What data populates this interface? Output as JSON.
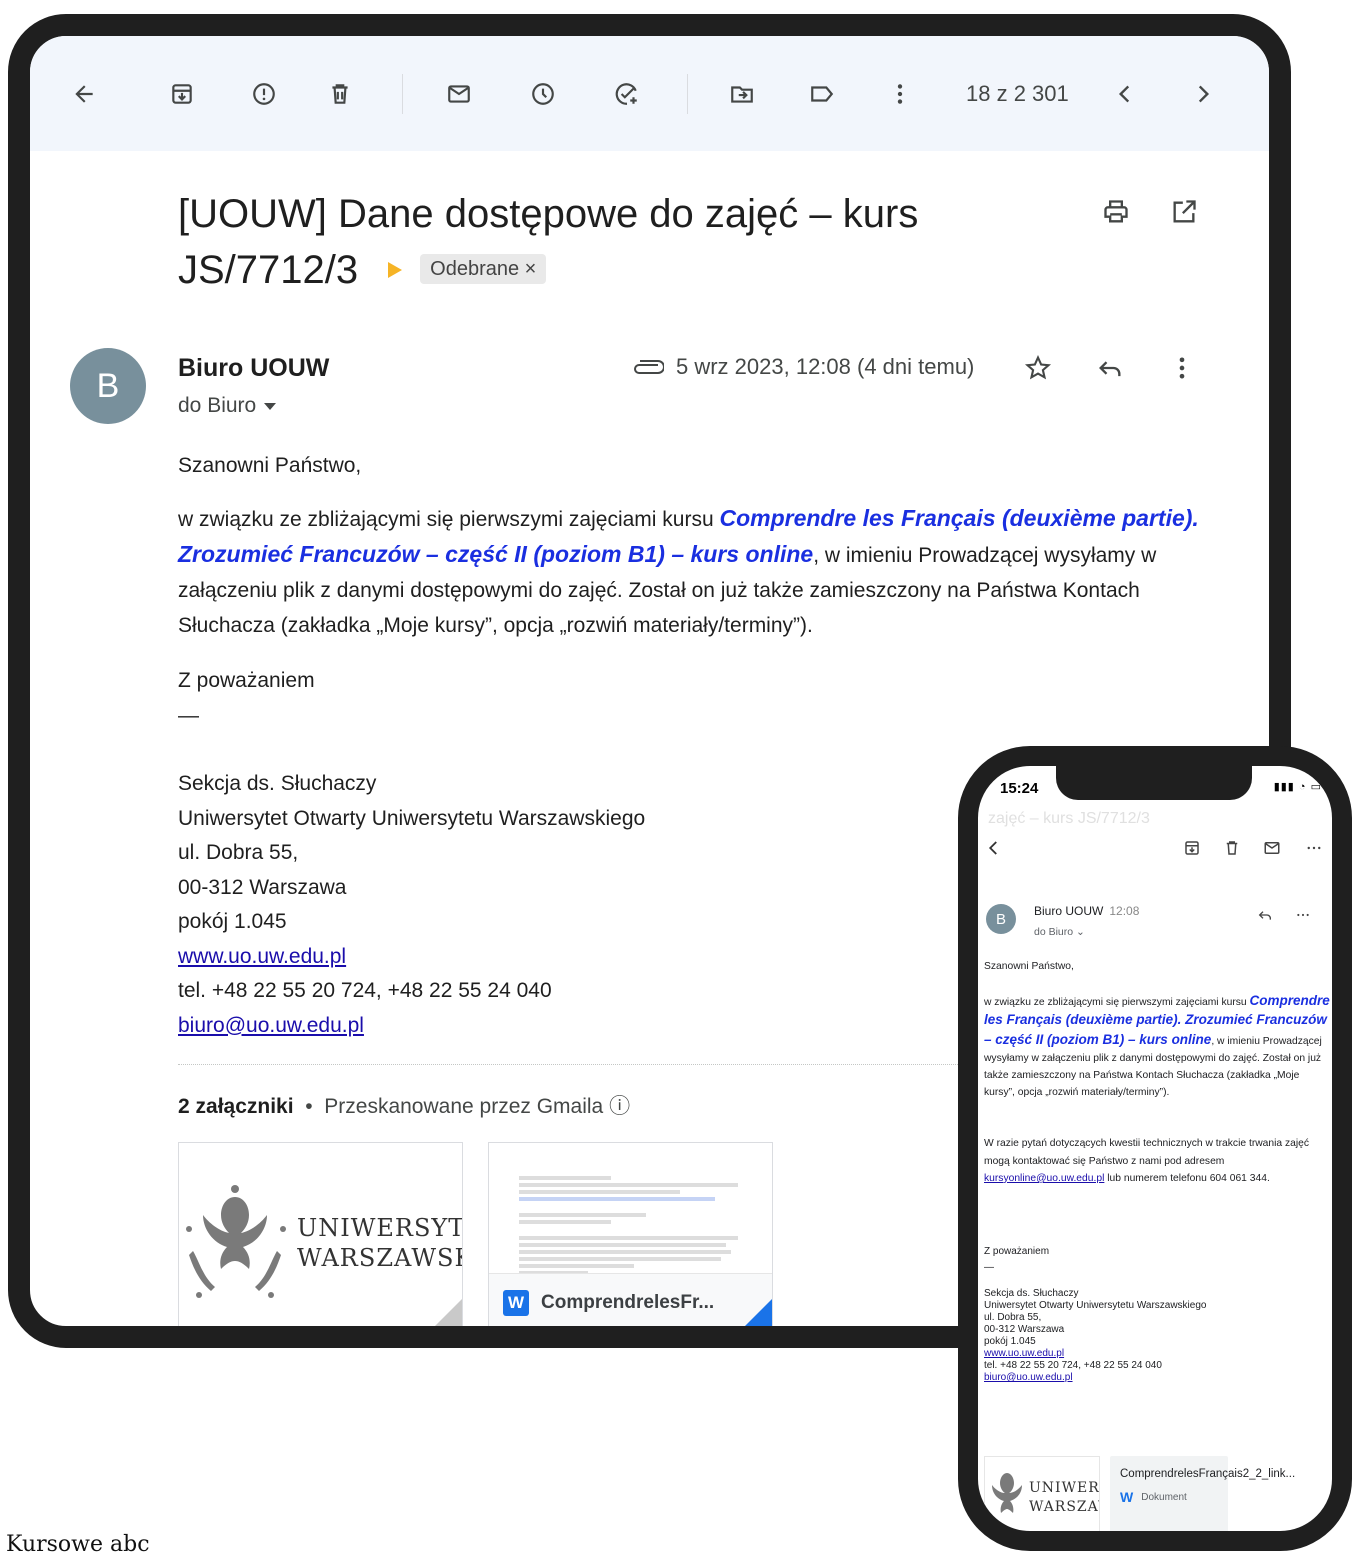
{
  "toolbar": {
    "counter": "18 z 2 301",
    "icons": [
      "back-arrow-icon",
      "archive-icon",
      "report-spam-icon",
      "delete-icon",
      "mark-unread-icon",
      "snooze-icon",
      "add-task-icon",
      "move-to-icon",
      "label-icon",
      "more-vert-icon",
      "chevron-left-icon",
      "chevron-right-icon"
    ]
  },
  "email": {
    "subject": "[UOUW] Dane dostępowe do zajęć – kurs JS/7712/3",
    "label_chip": "Odebrane",
    "chip_close": "×",
    "avatar_letter": "B",
    "sender": "Biuro UOUW",
    "recipient": "do Biuro",
    "date": "5 wrz 2023, 12:08 (4 dni temu)",
    "greeting": "Szanowni Państwo,",
    "para_intro": "w związku ze zbliżającymi się pierwszymi zajęciami kursu ",
    "course_title": "Comprendre les Français (deuxième partie). Zrozumieć Francuzów – część II (poziom B1) – kurs online",
    "para_rest": ", w imieniu Prowadzącej wysyłamy w załączeniu plik z danymi dostępowymi do zajęć. Został on już także zamieszczony na Państwa Kontach Słuchacza (zakładka „Moje kursy”, opcja „rozwiń materiały/terminy”).",
    "closing": "Z poważaniem",
    "dash": "—",
    "signature": {
      "line1": "Sekcja ds. Słuchaczy",
      "line2": "Uniwersytet Otwarty Uniwersytetu Warszawskiego",
      "line3": "ul. Dobra 55,",
      "line4": "00-312 Warszawa",
      "line5": "pokój 1.045",
      "website": "www.uo.uw.edu.pl",
      "phone": "tel. +48 22 55 20 724, +48 22 55 24 040",
      "email": "biuro@uo.uw.edu.pl"
    },
    "attachments": {
      "count_label": "2 załączniki",
      "scan_note": "Przeskanowane przez Gmaila",
      "logo_line1": "UNIWERSYTET",
      "logo_line2": "WARSZAWSKI",
      "doc_badge": "W",
      "doc_name": "ComprendrelesFr..."
    }
  },
  "phone": {
    "time": "15:24",
    "ghost_subject": "zajęć – kurs JS/7712/3",
    "avatar_letter": "B",
    "sender": "Biuro UOUW",
    "sent_time": "12:08",
    "recipient": "do Biuro ⌄",
    "greeting": "Szanowni Państwo,",
    "para_intro": "w związku ze zbliżającymi się pierwszymi zajęciami kursu ",
    "course_title": "Comprendre les Français (deuxième partie). Zrozumieć Francuzów – część II (poziom B1) – kurs online",
    "para_rest": ", w imieniu Prowadzącej wysyłamy w załączeniu plik z danymi dostępowymi do zajęć. Został on już także zamieszczony na Państwa Kontach Słuchacza (zakładka „Moje kursy”, opcja „rozwiń materiały/terminy”).",
    "tech_intro": "W razie pytań dotyczących kwestii technicznych w trakcie trwania zajęć mogą kontaktować się Państwo z nami pod adresem ",
    "tech_email": "kursyonline@uo.uw.edu.pl",
    "tech_rest": " lub numerem telefonu 604 061 344.",
    "closing": "Z poważaniem",
    "dash": "—",
    "sig_line1": "Sekcja ds. Słuchaczy",
    "sig_line2": "Uniwersytet Otwarty Uniwersytetu Warszawskiego",
    "sig_line3": "ul. Dobra 55,",
    "sig_line4": "00-312 Warszawa",
    "sig_line5": "pokój 1.045",
    "sig_website": "www.uo.uw.edu.pl",
    "sig_phone": "tel. +48 22 55 20 724, +48 22 55 24 040",
    "sig_email": "biuro@uo.uw.edu.pl",
    "att_logo_line1": "UNIWERS",
    "att_logo_line2": "WARSZAV",
    "att_doc_name": "ComprendrelesFrançais2_2_link...",
    "att_doc_badge": "W",
    "att_doc_type": "Dokument"
  },
  "caption": "Kursowe abc"
}
